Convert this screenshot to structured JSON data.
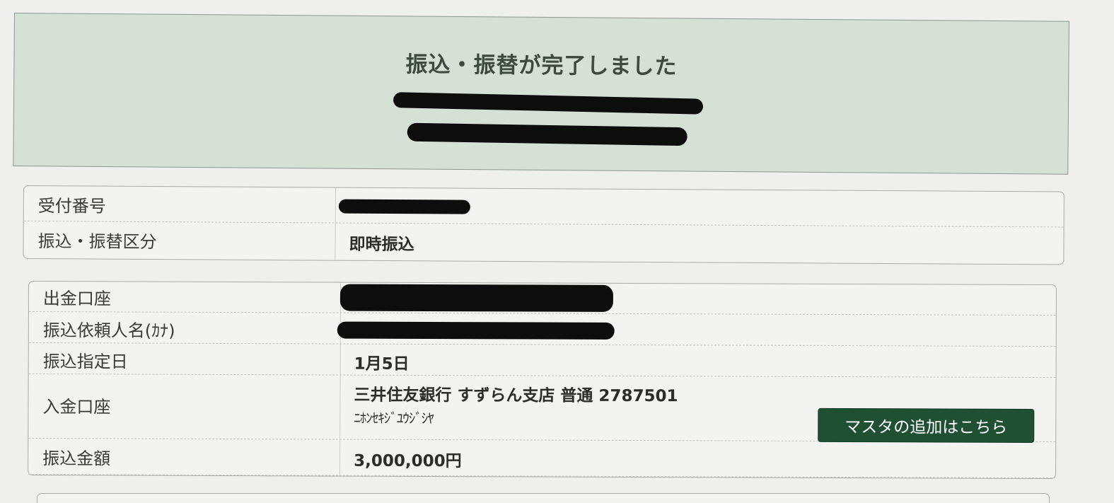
{
  "banner": {
    "title": "振込・振替が完了しました"
  },
  "summary": {
    "rows": [
      {
        "label": "受付番号",
        "value": ""
      },
      {
        "label": "振込・振替区分",
        "value": "即時振込"
      }
    ]
  },
  "details": {
    "rows": [
      {
        "label": "出金口座",
        "value": ""
      },
      {
        "label": "振込依頼人名(ｶﾅ)",
        "value": ""
      },
      {
        "label": "振込指定日",
        "value": "1月5日"
      },
      {
        "label": "入金口座",
        "value": "三井住友銀行 すずらん支店 普通 2787501",
        "sub": "ﾆﾎﾝｾｷｼﾞﾕｳｼﾞｼﾔ"
      },
      {
        "label": "振込金額",
        "value": "3,000,000円"
      }
    ],
    "master_button_label": "マスタの追加はこちら"
  },
  "colors": {
    "banner_bg": "#d5e0d7",
    "button_bg": "#1f5034",
    "page_bg": "#efefed"
  }
}
